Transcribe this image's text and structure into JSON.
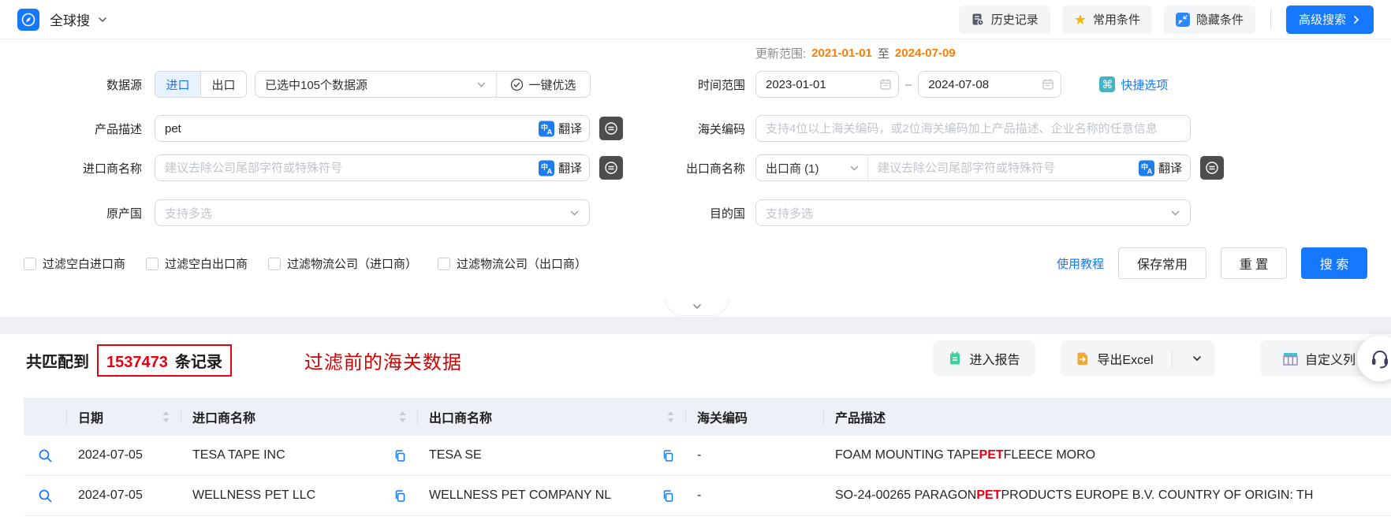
{
  "colors": {
    "accent": "#1677ff",
    "highlight_red": "#e60012",
    "date_orange": "#ff7d00"
  },
  "topbar": {
    "app_title": "全球搜",
    "history": "历史记录",
    "favorites": "常用条件",
    "hide_conditions": "隐藏条件",
    "advanced_search": "高级搜索"
  },
  "update_range": {
    "label": "更新范围:",
    "start": "2021-01-01",
    "to": "至",
    "end": "2024-07-09"
  },
  "form": {
    "data_source": {
      "label": "数据源",
      "import_tab": "进口",
      "export_tab": "出口",
      "selected": "已选中105个数据源",
      "one_click": "一键优选"
    },
    "time_range": {
      "label": "时间范围",
      "start": "2023-01-01",
      "dash": "–",
      "end": "2024-07-08",
      "quick_options": "快捷选项"
    },
    "product_desc": {
      "label": "产品描述",
      "value": "pet",
      "translate": "翻译"
    },
    "hs_code": {
      "label": "海关编码",
      "placeholder": "支持4位以上海关编码，或2位海关编码加上产品描述、企业名称的任意信息"
    },
    "importer": {
      "label": "进口商名称",
      "placeholder": "建议去除公司尾部字符或特殊符号",
      "translate": "翻译"
    },
    "exporter": {
      "label": "出口商名称",
      "type_select": "出口商 (1)",
      "placeholder": "建议去除公司尾部字符或特殊符号",
      "translate": "翻译"
    },
    "origin_country": {
      "label": "原产国",
      "placeholder": "支持多选"
    },
    "dest_country": {
      "label": "目的国",
      "placeholder": "支持多选"
    },
    "filters": [
      "过滤空白进口商",
      "过滤空白出口商",
      "过滤物流公司（进口商）",
      "过滤物流公司（出口商）"
    ],
    "tutorial_link": "使用教程",
    "save_button": "保存常用",
    "reset_button": "重 置",
    "search_button": "搜 索"
  },
  "results": {
    "match_prefix": "共匹配到",
    "match_count": "1537473",
    "match_suffix": "条记录",
    "annotation": "过滤前的海关数据",
    "report_button": "进入报告",
    "export_button": "导出Excel",
    "custom_columns_button": "自定义列"
  },
  "table": {
    "highlight": "PET",
    "columns": [
      {
        "label": "",
        "sortable": false
      },
      {
        "label": "日期",
        "sortable": true
      },
      {
        "label": "进口商名称",
        "sortable": true
      },
      {
        "label": "出口商名称",
        "sortable": true
      },
      {
        "label": "海关编码",
        "sortable": false
      },
      {
        "label": "产品描述",
        "sortable": false
      }
    ],
    "rows": [
      {
        "date": "2024-07-05",
        "importer": "TESA TAPE INC",
        "exporter": "TESA SE",
        "hs_code": "-",
        "description": "FOAM MOUNTING TAPE PET FLEECE MORO"
      },
      {
        "date": "2024-07-05",
        "importer": "WELLNESS PET LLC",
        "exporter": "WELLNESS PET COMPANY NL",
        "hs_code": "-",
        "description": "SO-24-00265 PARAGON PET PRODUCTS EUROPE B.V. COUNTRY OF ORIGIN: TH"
      }
    ]
  }
}
